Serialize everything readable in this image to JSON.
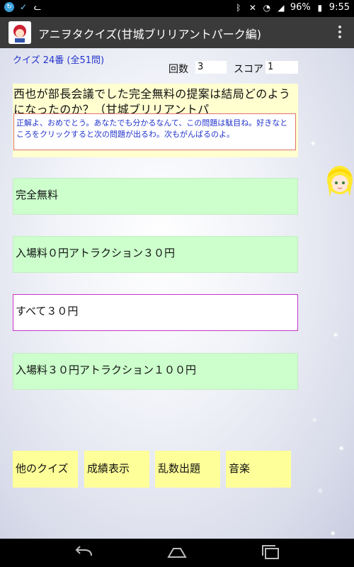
{
  "status_bar": {
    "battery": "96%",
    "time": "9:55",
    "icons": [
      "sync-icon",
      "vpn-icon",
      "cat-icon",
      "bluetooth-icon",
      "mute-icon",
      "wifi-icon",
      "signal-icon",
      "battery-icon"
    ]
  },
  "app_bar": {
    "title": "アニヲタクイズ(甘城ブリリアントパーク編)",
    "icon": "app-character-icon",
    "menu_icon": "overflow-menu-icon"
  },
  "quiz": {
    "number_text": "クイズ 24番 (全51問)",
    "count_label": "回数",
    "count_value": "3",
    "score_label": "スコア",
    "score_value": "1",
    "question": "西也が部長会議でした完全無料の提案は結局どのようになったのか？（甘城ブリリアントパ",
    "message": "正解よ、おめでとう。あなたでも分かるなんて、この問題は駄目ね。好きなところをクリックすると次の問題が出るわ。次もがんばるのよ。",
    "answers": [
      {
        "label": "完全無料",
        "selected": false
      },
      {
        "label": "入場料０円アトラクション３０円",
        "selected": false
      },
      {
        "label": "すべて３０円",
        "selected": true
      },
      {
        "label": "入場料３０円アトラクション１００円",
        "selected": false
      }
    ]
  },
  "bottom_buttons": {
    "other_quiz": "他のクイズ",
    "results": "成績表示",
    "random": "乱数出題",
    "music": "音楽"
  },
  "colors": {
    "quiz_number": "#2233cc",
    "question_bg": "#ffffd0",
    "answer_bg": "#ccffcc",
    "selected_border": "#cc33cc",
    "button_bg": "#ffff99",
    "action_bar": "#3a3a3a"
  }
}
